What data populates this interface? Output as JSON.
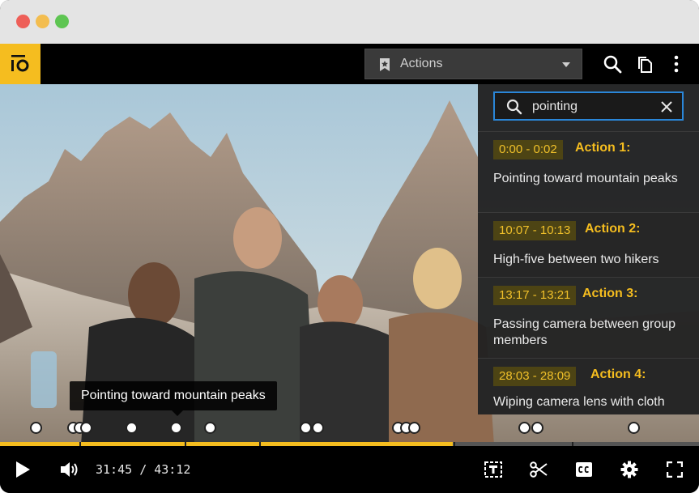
{
  "app": {
    "logo_text": "iO",
    "actions_dropdown": {
      "label": "Actions"
    }
  },
  "search": {
    "value": "pointing"
  },
  "results": [
    {
      "time": "0:00 - 0:02",
      "label": "Action 1:",
      "description": "Pointing toward mountain peaks"
    },
    {
      "time": "10:07 - 10:13",
      "label": "Action 2:",
      "description": "High-five between two hikers"
    },
    {
      "time": "13:17 - 13:21",
      "label": "Action 3:",
      "description": "Passing camera between group members"
    },
    {
      "time": "28:03 - 28:09",
      "label": "Action 4:",
      "description": "Wiping camera lens with cloth"
    }
  ],
  "video": {
    "caption": "Pointing toward mountain peaks",
    "progress_fraction": 0.648
  },
  "player": {
    "current_time": "31:45",
    "separator": "/",
    "duration": "43:12"
  },
  "colors": {
    "accent": "#f5bd1f",
    "search_border": "#2a86d8"
  }
}
